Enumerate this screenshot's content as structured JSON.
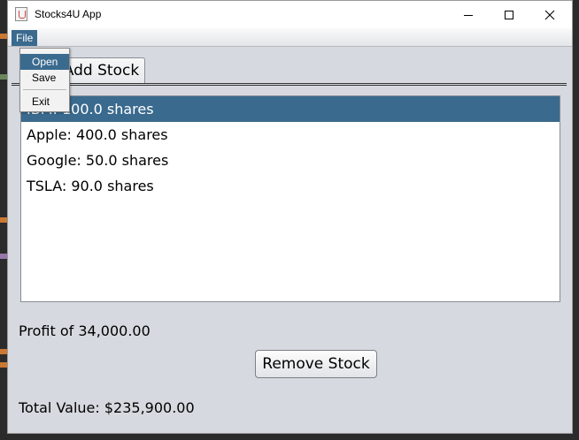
{
  "window": {
    "title": "Stocks4U App",
    "icon": "java-cup-icon"
  },
  "menubar": {
    "file_label": "File"
  },
  "file_menu": {
    "items": [
      "Open",
      "Save",
      "Exit"
    ],
    "highlighted": "Open"
  },
  "tabs": {
    "add_stock_label": "Add Stock"
  },
  "stock_list": {
    "items": [
      "IBM: 100.0 shares",
      "Apple: 400.0 shares",
      "Google: 50.0 shares",
      "TSLA: 90.0 shares"
    ],
    "selected_index": 0
  },
  "profit_text": "Profit of 34,000.00",
  "remove_button_label": "Remove Stock",
  "total_value_text": "Total Value: $235,900.00",
  "colors": {
    "selection": "#3a6a8e",
    "window_bg": "#d6d9df"
  }
}
